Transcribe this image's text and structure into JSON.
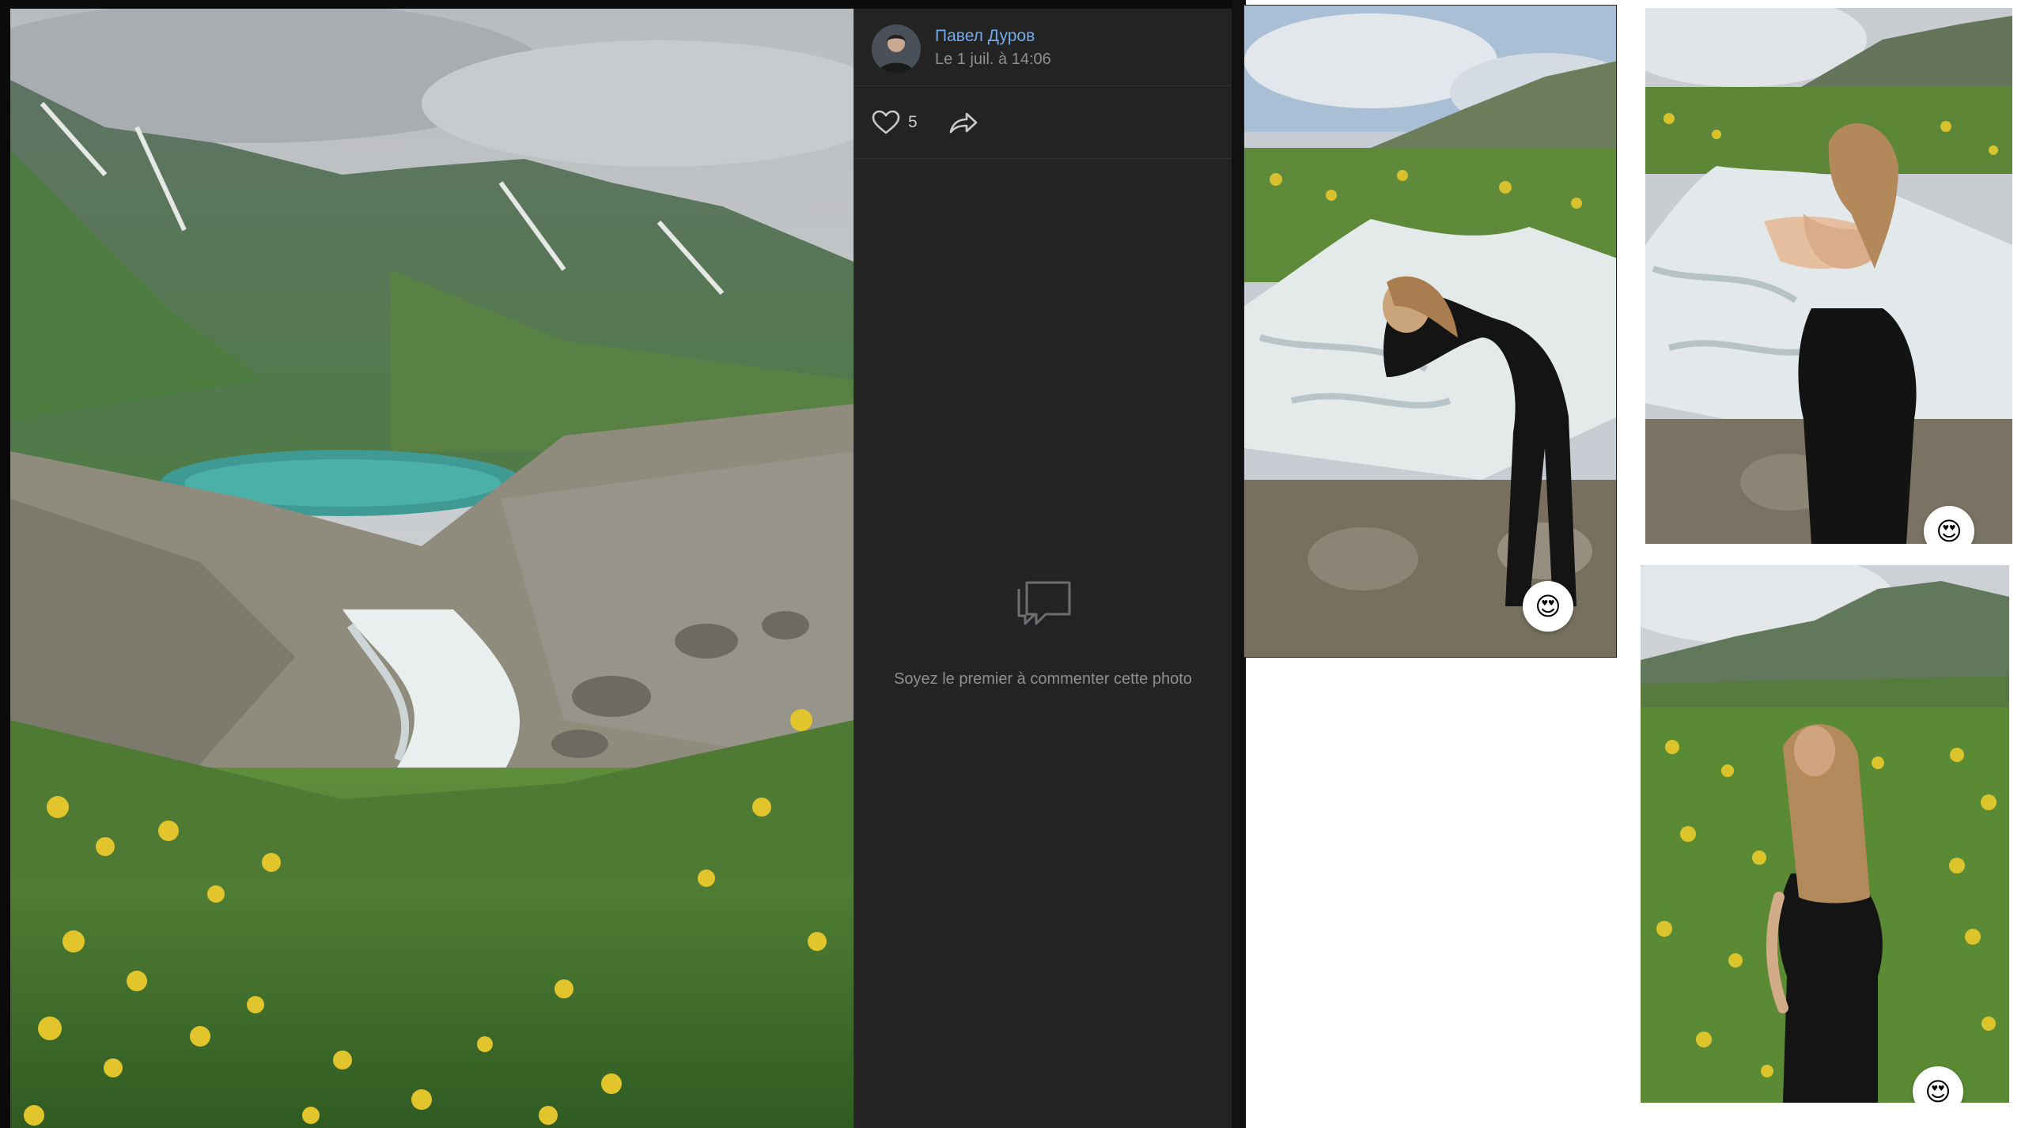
{
  "post": {
    "author_name": "Павел Дуров",
    "date": "Le 1 juil. à 14:06",
    "likes": "5",
    "empty_comments": "Soyez le premier à commenter cette photo"
  },
  "photo": {
    "subject": "mountain valley with turquoise lake, rushing stream and yellow wildflowers"
  },
  "thumbnails": [
    {
      "subject": "woman bending over a mountain stream",
      "reaction": "😍"
    },
    {
      "subject": "woman holding cupped hands toward camera by a stream",
      "reaction": "😍"
    },
    {
      "subject": "woman standing in a field of yellow flowers below mountains",
      "reaction": "😍"
    }
  ],
  "icons": {
    "like": "heart-icon",
    "share": "share-arrow-icon",
    "comments": "comment-bubbles-icon"
  },
  "colors": {
    "panel_bg": "#232324",
    "author_link": "#71aaeb",
    "muted_text": "#8d8f93",
    "page_bg": "#ffffff"
  }
}
